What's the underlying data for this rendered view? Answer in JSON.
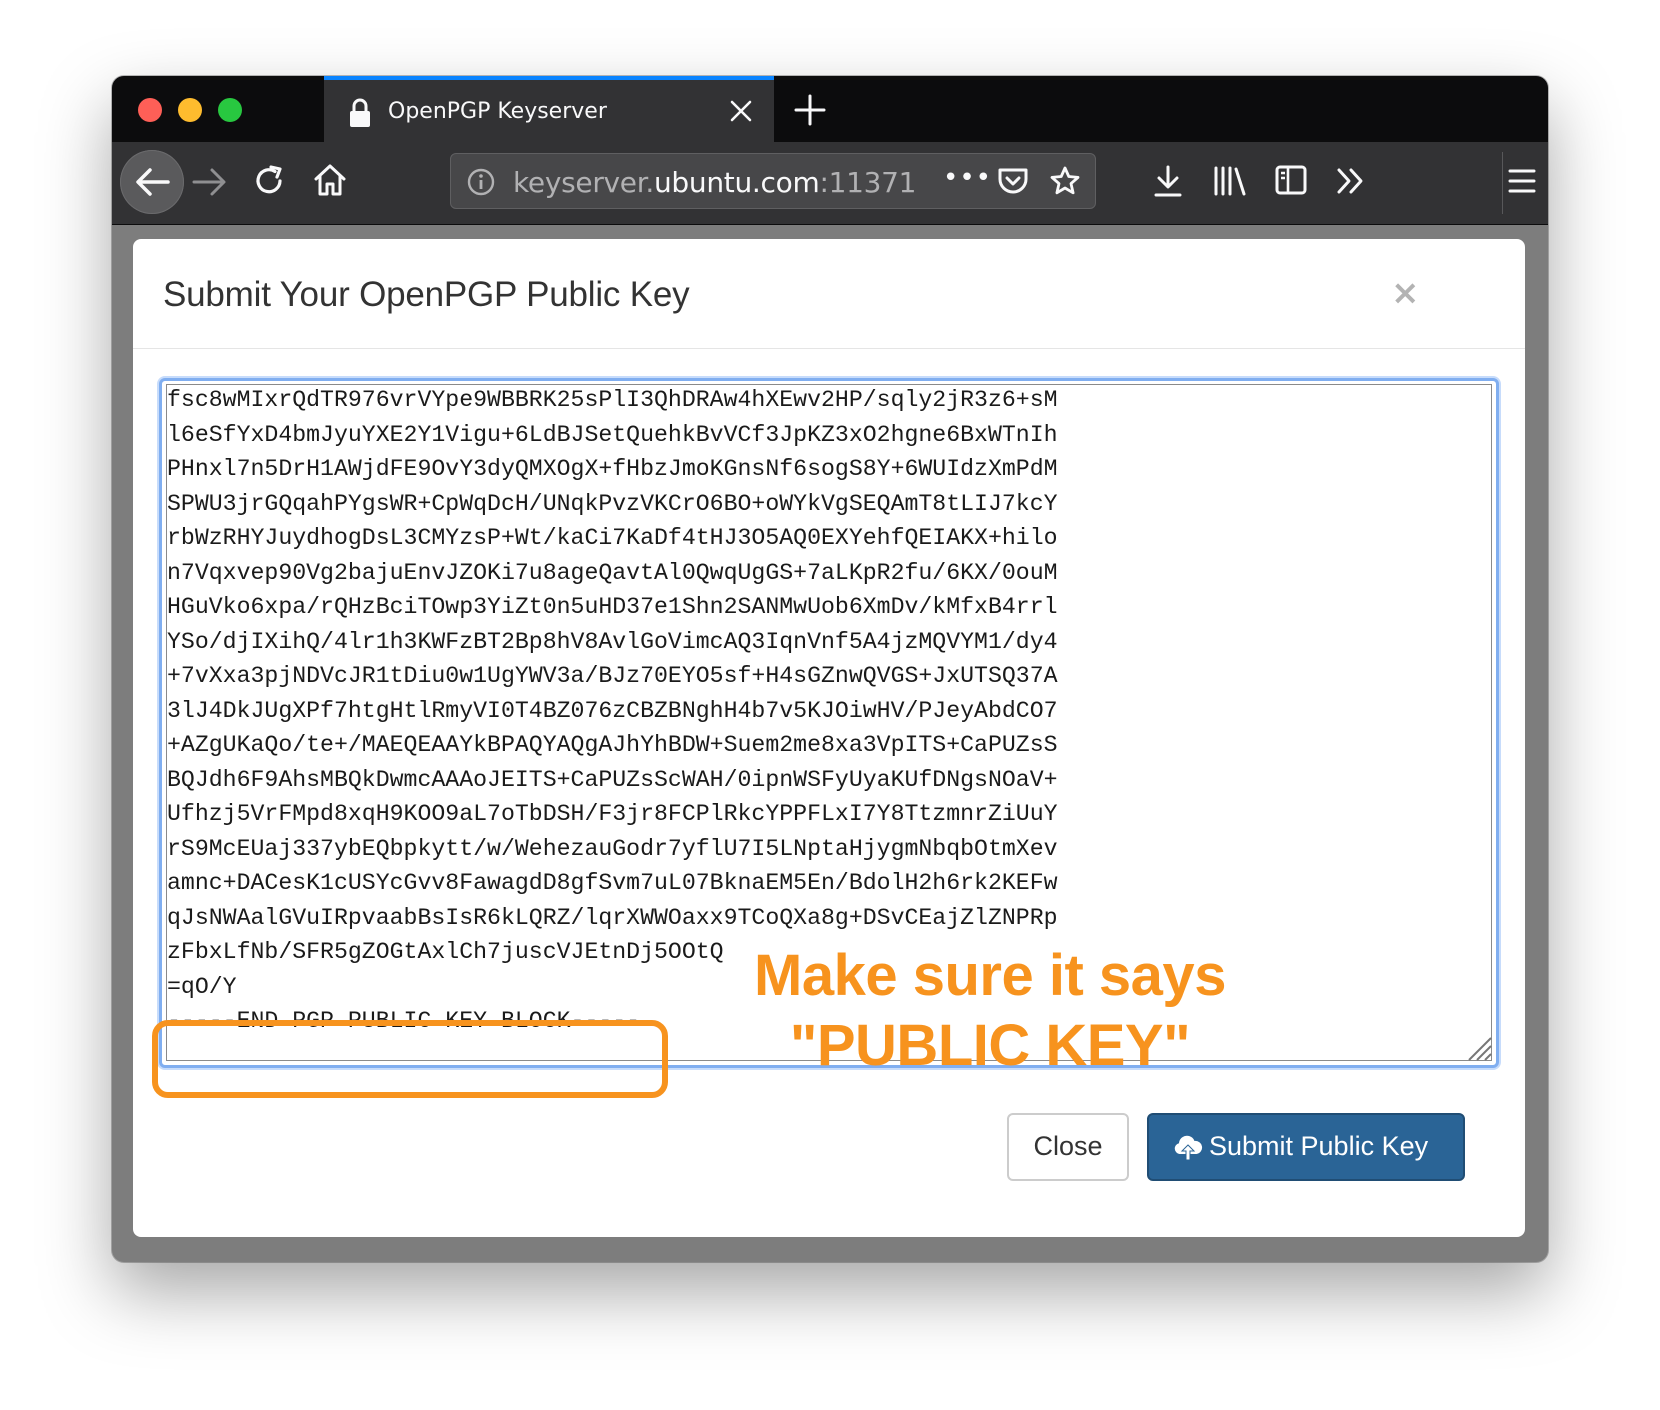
{
  "browser": {
    "tab_title": "OpenPGP Keyserver",
    "url_prefix": "keyserver.",
    "url_host": "ubuntu.com",
    "url_suffix": ":11371",
    "page_actions_label": "•••"
  },
  "modal": {
    "title": "Submit Your OpenPGP Public Key",
    "close_x": "×",
    "key_lines": [
      "fsc8wMIxrQdTR976vrVYpe9WBBRK25sPlI3QhDRAw4hXEwv2HP/sqly2jR3z6+sM",
      "l6eSfYxD4bmJyuYXE2Y1Vigu+6LdBJSetQuehkBvVCf3JpKZ3xO2hgne6BxWTnIh",
      "PHnxl7n5DrH1AWjdFE9OvY3dyQMXOgX+fHbzJmoKGnsNf6sogS8Y+6WUIdzXmPdM",
      "SPWU3jrGQqahPYgsWR+CpWqDcH/UNqkPvzVKCrO6BO+oWYkVgSEQAmT8tLIJ7kcY",
      "rbWzRHYJuydhogDsL3CMYzsP+Wt/kaCi7KaDf4tHJ3O5AQ0EXYehfQEIAKX+hilo",
      "n7Vqxvep90Vg2bajuEnvJZOKi7u8ageQavtAl0QwqUgGS+7aLKpR2fu/6KX/0ouM",
      "HGuVko6xpa/rQHzBciTOwp3YiZt0n5uHD37e1Shn2SANMwUob6XmDv/kMfxB4rrl",
      "YSo/djIXihQ/4lr1h3KWFzBT2Bp8hV8AvlGoVimcAQ3IqnVnf5A4jzMQVYM1/dy4",
      "+7vXxa3pjNDVcJR1tDiu0w1UgYWV3a/BJz70EYO5sf+H4sGZnwQVGS+JxUTSQ37A",
      "3lJ4DkJUgXPf7htgHtlRmyVI0T4BZ076zCBZBNghH4b7v5KJOiwHV/PJeyAbdCO7",
      "+AZgUKaQo/te+/MAEQEAAYkBPAQYAQgAJhYhBDW+Suem2me8xa3VpITS+CaPUZsS",
      "BQJdh6F9AhsMBQkDwmcAAAoJEITS+CaPUZsScWAH/0ipnWSFyUyaKUfDNgsNOaV+",
      "Ufhzj5VrFMpd8xqH9KOO9aL7oTbDSH/F3jr8FCPlRkcYPPFLxI7Y8TtzmnrZiUuY",
      "rS9McEUaj337ybEQbpkytt/w/WehezauGodr7yflU7I5LNptaHjygmNbqbOtmXev",
      "amnc+DACesK1cUSYcGvv8FawagdD8gfSvm7uL07BknaEM5En/BdolH2h6rk2KEFw",
      "qJsNWAalGVuIRpvaabBsIsR6kLQRZ/lqrXWWOaxx9TCoQXa8g+DSvCEajZlZNPRp",
      "zFbxLfNb/SFR5gZOGtAxlCh7juscVJEtnDj5OOtQ",
      "=qO/Y",
      "-----END PGP PUBLIC KEY BLOCK-----"
    ],
    "annotation_line1": "Make sure it says",
    "annotation_line2": "\"PUBLIC KEY\"",
    "close_button": "Close",
    "submit_button": "Submit Public Key"
  },
  "colors": {
    "accent_orange": "#f7931e",
    "submit_blue": "#2a6496",
    "tab_highlight": "#0a84ff"
  },
  "icons": [
    "lock-icon",
    "close-icon",
    "plus-icon",
    "back-arrow-icon",
    "forward-arrow-icon",
    "reload-icon",
    "home-icon",
    "info-icon",
    "more-icon",
    "pocket-icon",
    "star-icon",
    "download-icon",
    "library-icon",
    "sidebar-icon",
    "overflow-icon",
    "menu-icon",
    "cloud-upload-icon",
    "resize-grip-icon"
  ]
}
